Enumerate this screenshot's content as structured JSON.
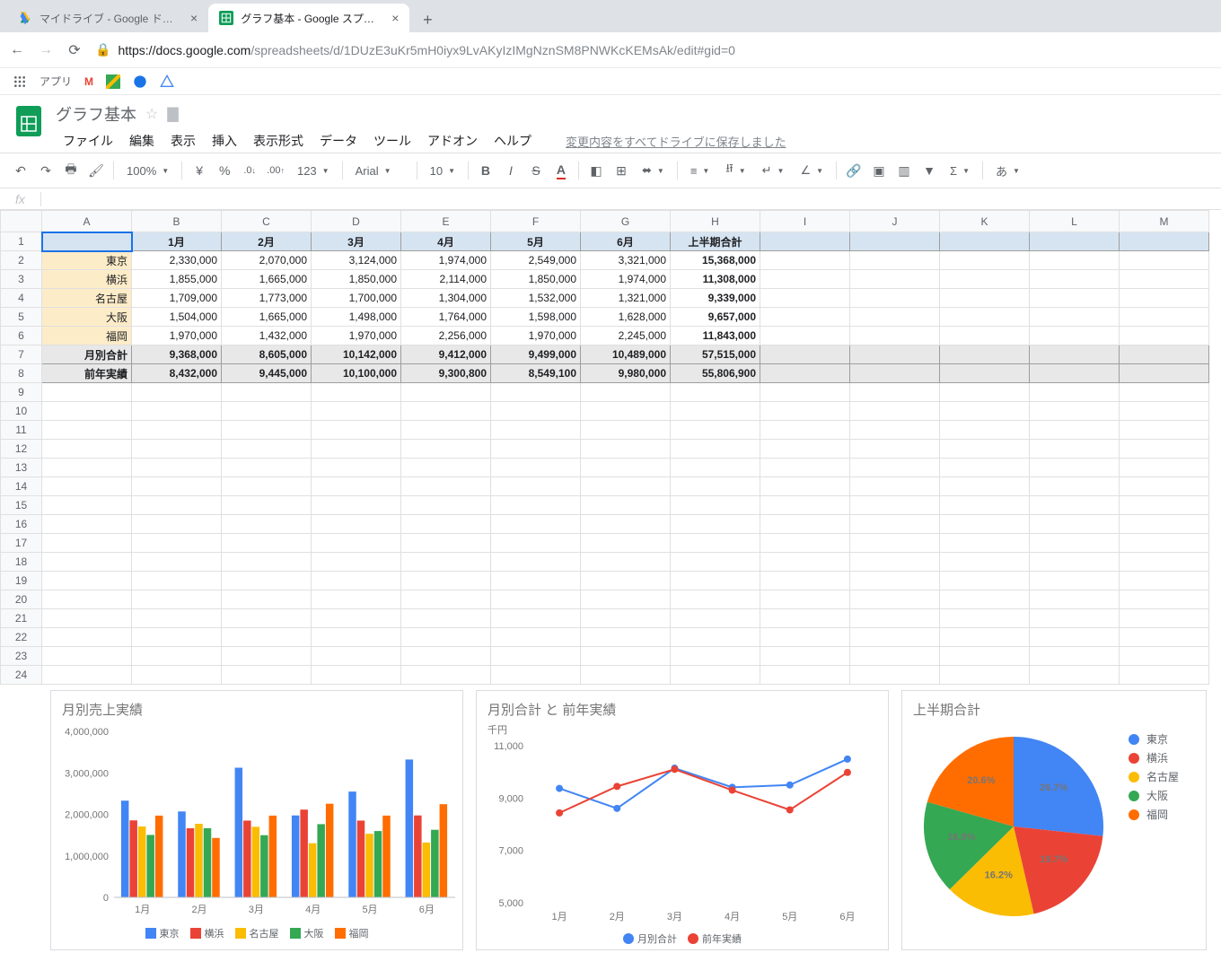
{
  "browser": {
    "tabs": [
      {
        "title": "マイドライブ - Google ドライブ",
        "active": false
      },
      {
        "title": "グラフ基本 - Google スプレッドシート",
        "active": true
      }
    ],
    "url_host": "https://docs.google.com",
    "url_path": "/spreadsheets/d/1DUzE3uKr5mH0iyx9LvAKyIzIMgNznSM8PNWKcKEMsAk/edit#gid=0",
    "apps_label": "アプリ"
  },
  "doc": {
    "title": "グラフ基本",
    "menus": [
      "ファイル",
      "編集",
      "表示",
      "挿入",
      "表示形式",
      "データ",
      "ツール",
      "アドオン",
      "ヘルプ"
    ],
    "save_msg": "変更内容をすべてドライブに保存しました"
  },
  "toolbar": {
    "zoom": "100%",
    "currency": "¥",
    "percent": "%",
    "dec_dec": ".0",
    "dec_inc": ".00",
    "numfmt": "123",
    "font": "Arial",
    "size": "10",
    "lang": "あ"
  },
  "columns": [
    "A",
    "B",
    "C",
    "D",
    "E",
    "F",
    "G",
    "H",
    "I",
    "J",
    "K",
    "L",
    "M"
  ],
  "table": {
    "headers": [
      "",
      "1月",
      "2月",
      "3月",
      "4月",
      "5月",
      "6月",
      "上半期合計"
    ],
    "rows": [
      {
        "label": "東京",
        "vals": [
          "2,330,000",
          "2,070,000",
          "3,124,000",
          "1,974,000",
          "2,549,000",
          "3,321,000",
          "15,368,000"
        ]
      },
      {
        "label": "横浜",
        "vals": [
          "1,855,000",
          "1,665,000",
          "1,850,000",
          "2,114,000",
          "1,850,000",
          "1,974,000",
          "11,308,000"
        ]
      },
      {
        "label": "名古屋",
        "vals": [
          "1,709,000",
          "1,773,000",
          "1,700,000",
          "1,304,000",
          "1,532,000",
          "1,321,000",
          "9,339,000"
        ]
      },
      {
        "label": "大阪",
        "vals": [
          "1,504,000",
          "1,665,000",
          "1,498,000",
          "1,764,000",
          "1,598,000",
          "1,628,000",
          "9,657,000"
        ]
      },
      {
        "label": "福岡",
        "vals": [
          "1,970,000",
          "1,432,000",
          "1,970,000",
          "2,256,000",
          "1,970,000",
          "2,245,000",
          "11,843,000"
        ]
      }
    ],
    "totals": [
      {
        "label": "月別合計",
        "vals": [
          "9,368,000",
          "8,605,000",
          "10,142,000",
          "9,412,000",
          "9,499,000",
          "10,489,000",
          "57,515,000"
        ]
      },
      {
        "label": "前年実績",
        "vals": [
          "8,432,000",
          "9,445,000",
          "10,100,000",
          "9,300,800",
          "8,549,100",
          "9,980,000",
          "55,806,900"
        ]
      }
    ]
  },
  "chart_data": [
    {
      "type": "bar",
      "title": "月別売上実績",
      "xlabel": "",
      "ylabel": "",
      "categories": [
        "1月",
        "2月",
        "3月",
        "4月",
        "5月",
        "6月"
      ],
      "series": [
        {
          "name": "東京",
          "color": "#4285f4",
          "values": [
            2330000,
            2070000,
            3124000,
            1974000,
            2549000,
            3321000
          ]
        },
        {
          "name": "横浜",
          "color": "#ea4335",
          "values": [
            1855000,
            1665000,
            1850000,
            2114000,
            1850000,
            1974000
          ]
        },
        {
          "name": "名古屋",
          "color": "#fbbc04",
          "values": [
            1709000,
            1773000,
            1700000,
            1304000,
            1532000,
            1321000
          ]
        },
        {
          "name": "大阪",
          "color": "#34a853",
          "values": [
            1504000,
            1665000,
            1498000,
            1764000,
            1598000,
            1628000
          ]
        },
        {
          "name": "福岡",
          "color": "#ff6d01",
          "values": [
            1970000,
            1432000,
            1970000,
            2256000,
            1970000,
            2245000
          ]
        }
      ],
      "ylim": [
        0,
        4000000
      ],
      "yticks": [
        "0",
        "1,000,000",
        "2,000,000",
        "3,000,000",
        "4,000,000"
      ]
    },
    {
      "type": "line",
      "title": "月別合計 と 前年実績",
      "subtitle": "千円",
      "categories": [
        "1月",
        "2月",
        "3月",
        "4月",
        "5月",
        "6月"
      ],
      "series": [
        {
          "name": "月別合計",
          "color": "#4285f4",
          "values": [
            9368,
            8605,
            10142,
            9412,
            9499,
            10489
          ]
        },
        {
          "name": "前年実績",
          "color": "#ea4335",
          "values": [
            8432,
            9445,
            10100,
            9301,
            8549,
            9980
          ]
        }
      ],
      "ylim": [
        5000,
        11000
      ],
      "yticks": [
        "5,000",
        "7,000",
        "9,000",
        "11,000"
      ]
    },
    {
      "type": "pie",
      "title": "上半期合計",
      "slices": [
        {
          "name": "東京",
          "color": "#4285f4",
          "value": 15368000,
          "pct": "26.7%"
        },
        {
          "name": "横浜",
          "color": "#ea4335",
          "value": 11308000,
          "pct": "19.7%"
        },
        {
          "name": "名古屋",
          "color": "#fbbc04",
          "value": 9339000,
          "pct": "16.2%"
        },
        {
          "name": "大阪",
          "color": "#34a853",
          "value": 9657000,
          "pct": "16.8%"
        },
        {
          "name": "福岡",
          "color": "#ff6d01",
          "value": 11843000,
          "pct": "20.6%"
        }
      ]
    }
  ]
}
